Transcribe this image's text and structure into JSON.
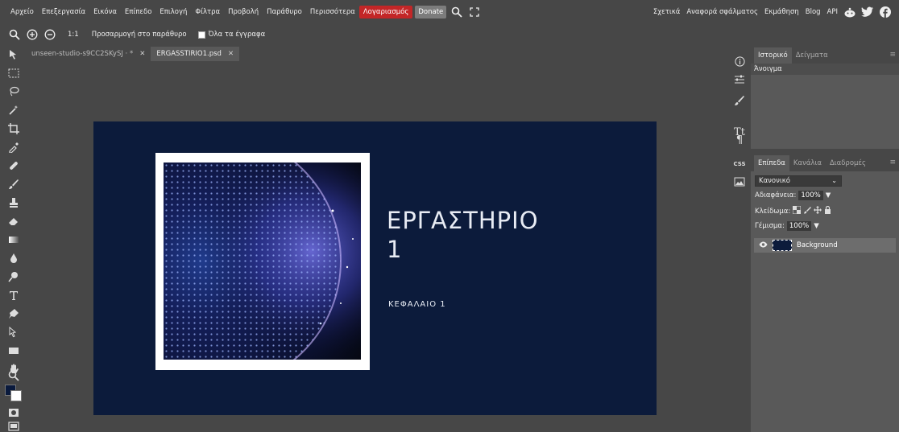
{
  "menubar": {
    "items": [
      "Αρχείο",
      "Επεξεργασία",
      "Εικόνα",
      "Επίπεδο",
      "Επιλογή",
      "Φίλτρα",
      "Προβολή",
      "Παράθυρο",
      "Περισσότερα"
    ],
    "account_label": "Λογαριασμός",
    "donate_label": "Donate",
    "right_items": [
      "Σχετικά",
      "Αναφορά σφάλματος",
      "Εκμάθηση",
      "Blog",
      "API"
    ]
  },
  "options": {
    "ratio_label": "1:1",
    "fit_label": "Προσαρμογή στο παράθυρο",
    "all_docs_label": "Όλα τα έγγραφα"
  },
  "tabs": [
    {
      "label": "unseen-studio-s9CC2SKySJ · *",
      "active": false
    },
    {
      "label": "ERGASSTIRIO1.psd",
      "active": true
    }
  ],
  "document": {
    "title_line1": "ΕΡΓΑΣΤΗΡΙΟ",
    "title_line2": "1",
    "subtitle": "ΚΕΦΑΛΑΙΟ 1",
    "background_color": "#0c1b3b"
  },
  "history_panel": {
    "tabs": [
      "Ιστορικό",
      "Δείγματα"
    ],
    "entries": [
      "Άνοιγμα"
    ]
  },
  "layers_panel": {
    "tabs": [
      "Επίπεδα",
      "Κανάλια",
      "Διαδρομές"
    ],
    "blend_mode": "Κανονικό",
    "opacity_label": "Αδιαφάνεια:",
    "opacity_value": "100%",
    "lock_label": "Κλείδωμα:",
    "fill_label": "Γέμισμα:",
    "fill_value": "100%",
    "layers": [
      {
        "name": "Background"
      }
    ]
  },
  "side_icons": [
    "info-icon",
    "adjustments-icon",
    "brush-settings-icon",
    "character-icon",
    "paragraph-icon",
    "css-icon",
    "image-icon"
  ]
}
